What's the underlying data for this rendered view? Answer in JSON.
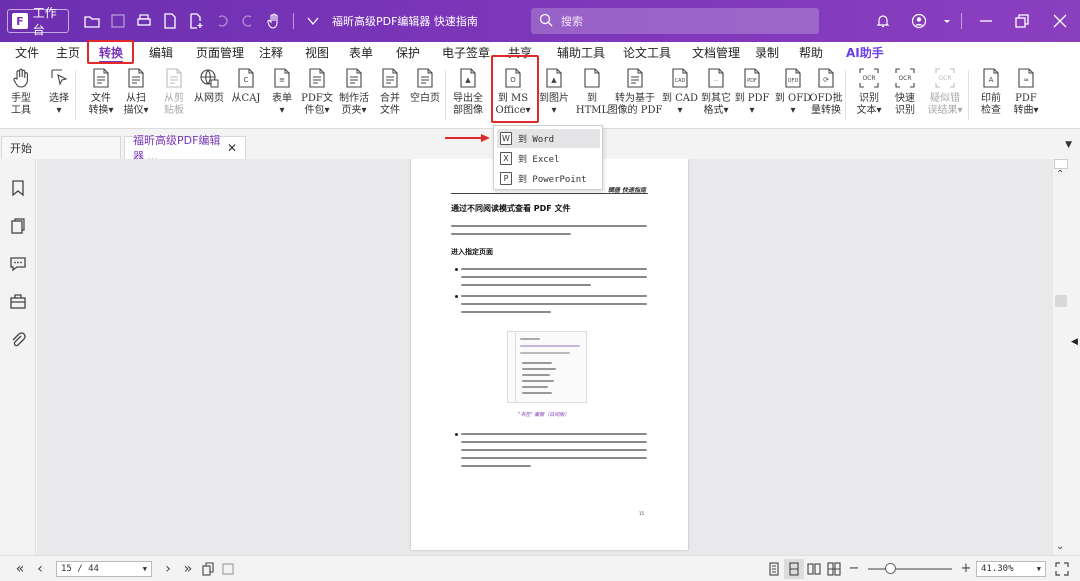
{
  "titlebar": {
    "workspace_label": "工作台",
    "doc_title": "福昕高级PDF编辑器 快速指南",
    "search_placeholder": "搜索"
  },
  "menu": {
    "items": [
      "文件",
      "主页",
      "转换",
      "编辑",
      "页面管理",
      "注释",
      "视图",
      "表单",
      "保护",
      "电子签章",
      "共享",
      "辅助工具",
      "论文工具",
      "文档管理",
      "录制",
      "帮助",
      "AI助手"
    ],
    "active_index": 2
  },
  "ribbon": {
    "buttons": [
      {
        "l1": "手型",
        "l2": "工具",
        "icon": "hand-icon"
      },
      {
        "l1": "选择",
        "l2": "▾",
        "icon": "select-cursor-icon"
      },
      {
        "l1": "文件",
        "l2": "转换▾",
        "icon": "file-convert-icon"
      },
      {
        "l1": "从扫",
        "l2": "描仪▾",
        "icon": "scanner-icon"
      },
      {
        "l1": "从剪",
        "l2": "贴板",
        "icon": "clipboard-icon",
        "dim": true
      },
      {
        "l1": "从网页",
        "l2": "",
        "icon": "web-globe-icon"
      },
      {
        "l1": "从CAJ",
        "l2": "",
        "icon": "caj-file-icon"
      },
      {
        "l1": "表单",
        "l2": "▾",
        "icon": "form-icon"
      },
      {
        "l1": "PDF文",
        "l2": "件包▾",
        "icon": "pdf-package-icon"
      },
      {
        "l1": "制作活",
        "l2": "页夹▾",
        "icon": "binder-icon"
      },
      {
        "l1": "合并",
        "l2": "文件",
        "icon": "merge-files-icon"
      },
      {
        "l1": "空白页",
        "l2": "",
        "icon": "blank-page-icon"
      },
      {
        "l1": "导出全",
        "l2": "部图像",
        "icon": "export-images-icon"
      },
      {
        "l1": "到 MS",
        "l2": "Office▾",
        "icon": "ms-office-icon"
      },
      {
        "l1": "到图片",
        "l2": "▾",
        "icon": "to-image-icon"
      },
      {
        "l1": "到",
        "l2": "HTML",
        "icon": "to-html-icon"
      },
      {
        "l1": "转为基于",
        "l2": "图像的 PDF",
        "icon": "image-pdf-icon"
      },
      {
        "l1": "到 CAD",
        "l2": "▾",
        "icon": "to-cad-icon"
      },
      {
        "l1": "到其它",
        "l2": "格式▾",
        "icon": "other-format-icon"
      },
      {
        "l1": "到 PDF",
        "l2": "▾",
        "icon": "to-pdf-icon"
      },
      {
        "l1": "到 OFD",
        "l2": "▾",
        "icon": "to-ofd-icon"
      },
      {
        "l1": "OFD批",
        "l2": "量转换",
        "icon": "ofd-batch-icon"
      },
      {
        "l1": "识别",
        "l2": "文本▾",
        "icon": "ocr-icon"
      },
      {
        "l1": "快速",
        "l2": "识别",
        "icon": "quick-ocr-icon"
      },
      {
        "l1": "疑似错",
        "l2": "误结果▾",
        "icon": "ocr-suspect-icon",
        "dim": true
      },
      {
        "l1": "印前",
        "l2": "检查",
        "icon": "preflight-icon"
      },
      {
        "l1": "PDF",
        "l2": "转曲▾",
        "icon": "pdf-outline-icon"
      }
    ]
  },
  "tabs": {
    "start": "开始",
    "doc": "福昕高级PDF编辑器 ..."
  },
  "dropdown": {
    "items": [
      {
        "label": "到 Word",
        "icon": "W"
      },
      {
        "label": "到 Excel",
        "icon": "X"
      },
      {
        "label": "到 PowerPoint",
        "icon": "P"
      }
    ]
  },
  "page": {
    "header": "辑器 快速指南",
    "h1": "通过不同阅读模式查看 PDF 文件",
    "h2": "进入指定页面",
    "caption": "\"书签\" 面板（日间版）",
    "number": "15"
  },
  "status": {
    "page_field": "15 / 44",
    "zoom": "41.30%",
    "zoom_fraction": 0.413
  },
  "colors": {
    "brand": "#7a35b8",
    "highlight": "#e02a2a"
  }
}
